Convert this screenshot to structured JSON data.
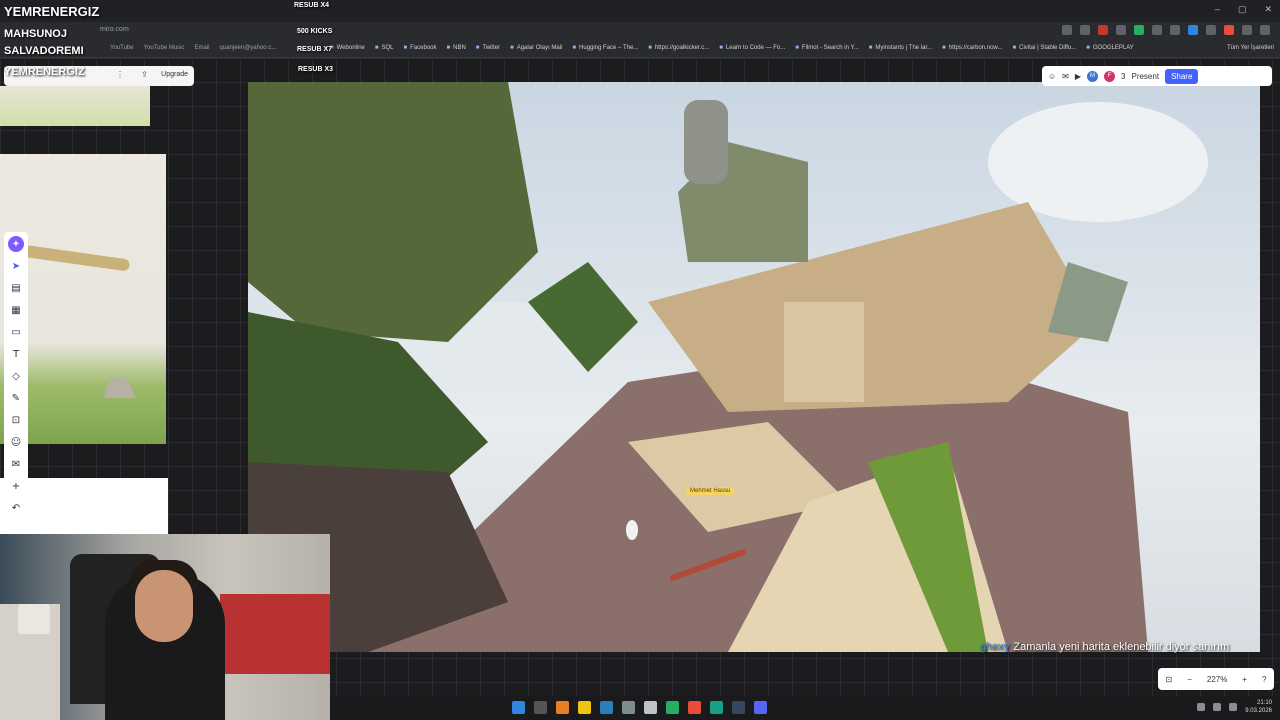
{
  "overlay": {
    "streamer_name": "YEMRENERGIZ",
    "sub_line1": "MAHSUNOJ",
    "sub_line2": "SALVADOREMI",
    "sub_line3": "YEMRENERGIZ",
    "alerts": [
      "RESUB X4",
      "500 KICKS",
      "RESUB X7",
      "RESUB X3"
    ]
  },
  "browser": {
    "url": "miro.com",
    "bookmarks_left": [
      "YouTube",
      "YouTube Music",
      "Email",
      "quanjeen@yahoo.c..."
    ],
    "bookmarks": [
      "Webonline",
      "SQL",
      "Facebook",
      "NBN",
      "Twitter",
      "Agalar Olayı Mail",
      "Hugging Face – The...",
      "https://goalkicker.c...",
      "Learn to Code — Fo...",
      "Filmot - Search in Y...",
      "Myinstants | The lar...",
      "https://carbon.now...",
      "Civitai | Stable Diffu...",
      "GOOGLEPLAY"
    ],
    "bookmarks_right": "Tüm Yer İşaretleri"
  },
  "miro": {
    "upgrade_label": "Upgrade",
    "collaborator_count": "3",
    "avatars": [
      "M",
      "F"
    ],
    "present_label": "Present",
    "share_label": "Share",
    "zoom_level": "227%"
  },
  "game": {
    "player_tag": "Mehmet Hassu",
    "chat_user": "ghexy",
    "chat_message": "Zamanla yeni harita eklenebilir diyor sanırım"
  },
  "system": {
    "time": "21:10",
    "date": "9.03.2026"
  },
  "colors": {
    "accent": "#4262ff",
    "share_bg": "#4262ff",
    "alert_bg": "#f6d365"
  }
}
